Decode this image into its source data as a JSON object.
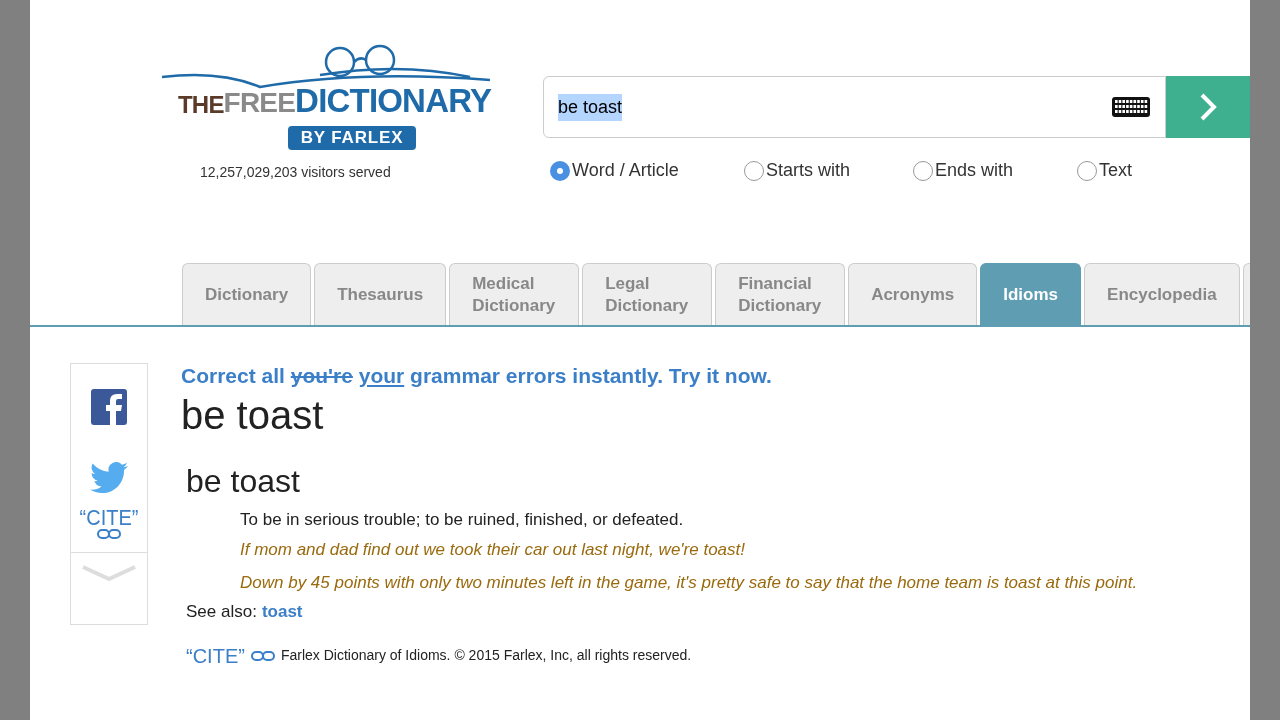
{
  "logo": {
    "the": "THE",
    "free": "FREE",
    "dictionary": "DICTIONARY",
    "by": "BY FARLEX"
  },
  "visitors": "12,257,029,203 visitors served",
  "search": {
    "value": "be toast",
    "selected_text": true
  },
  "search_modes": [
    {
      "label": "Word / Article",
      "selected": true
    },
    {
      "label": "Starts with",
      "selected": false
    },
    {
      "label": "Ends with",
      "selected": false
    },
    {
      "label": "Text",
      "selected": false
    }
  ],
  "tabs": [
    {
      "label": "Dictionary",
      "selected": false
    },
    {
      "label": "Thesaurus",
      "selected": false
    },
    {
      "label": "Medical Dictionary",
      "selected": false
    },
    {
      "label": "Legal Dictionary",
      "selected": false
    },
    {
      "label": "Financial Dictionary",
      "selected": false
    },
    {
      "label": "Acronyms",
      "selected": false
    },
    {
      "label": "Idioms",
      "selected": true
    },
    {
      "label": "Encyclopedia",
      "selected": false
    }
  ],
  "share": {
    "cite": "“CITE”"
  },
  "promo": [
    {
      "kind": "plain",
      "text": "Correct all"
    },
    {
      "kind": "struck",
      "text": "you're"
    },
    {
      "kind": "underlined",
      "text": "your"
    },
    {
      "kind": "plain",
      "text": "grammar errors instantly. Try it now."
    }
  ],
  "title": "be toast",
  "entry": {
    "headword": "be toast",
    "definition": "To be in serious trouble; to be ruined, finished, or defeated.",
    "examples": [
      "If mom and dad find out we took their car out last night, we're toast!",
      "Down by 45 points with only two minutes left in the game, it's pretty safe to say that the home team is toast at this point."
    ],
    "see_also_label": "See also:",
    "see_also_link": "toast"
  },
  "footer": {
    "cite": "“CITE”",
    "source": "Farlex Dictionary of Idioms. © 2015 Farlex, Inc, all rights reserved."
  }
}
